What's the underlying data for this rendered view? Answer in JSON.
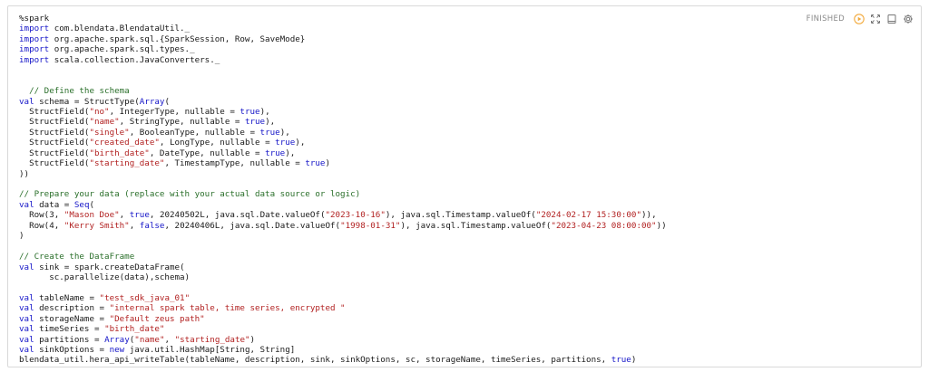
{
  "paragraph": {
    "status": "FINISHED",
    "icons": {
      "run": "play-circle-icon",
      "hide_editor": "expand-arrows-icon",
      "output": "book-icon",
      "settings": "gear-icon"
    },
    "colors": {
      "keyword": "#1515c8",
      "string": "#b22222",
      "comment": "#2a6f2a",
      "run_icon": "#f2a93b"
    }
  },
  "code": {
    "lines": [
      [
        {
          "t": "%spark",
          "c": ""
        }
      ],
      [
        {
          "t": "import",
          "c": "kw"
        },
        {
          "t": " com.blendata.BlendataUtil._",
          "c": ""
        }
      ],
      [
        {
          "t": "import",
          "c": "kw"
        },
        {
          "t": " org.apache.spark.sql.{SparkSession, Row, SaveMode}",
          "c": ""
        }
      ],
      [
        {
          "t": "import",
          "c": "kw"
        },
        {
          "t": " org.apache.spark.sql.types._",
          "c": ""
        }
      ],
      [
        {
          "t": "import",
          "c": "kw"
        },
        {
          "t": " scala.collection.JavaConverters._",
          "c": ""
        }
      ],
      [],
      [],
      [
        {
          "t": "  // Define the schema",
          "c": "cm"
        }
      ],
      [
        {
          "t": "val",
          "c": "kw"
        },
        {
          "t": " schema = StructType(",
          "c": ""
        },
        {
          "t": "Array",
          "c": "kw"
        },
        {
          "t": "(",
          "c": ""
        }
      ],
      [
        {
          "t": "  StructField(",
          "c": ""
        },
        {
          "t": "\"no\"",
          "c": "str"
        },
        {
          "t": ", IntegerType, nullable = ",
          "c": ""
        },
        {
          "t": "true",
          "c": "bool"
        },
        {
          "t": "),",
          "c": ""
        }
      ],
      [
        {
          "t": "  StructField(",
          "c": ""
        },
        {
          "t": "\"name\"",
          "c": "str"
        },
        {
          "t": ", StringType, nullable = ",
          "c": ""
        },
        {
          "t": "true",
          "c": "bool"
        },
        {
          "t": "),",
          "c": ""
        }
      ],
      [
        {
          "t": "  StructField(",
          "c": ""
        },
        {
          "t": "\"single\"",
          "c": "str"
        },
        {
          "t": ", BooleanType, nullable = ",
          "c": ""
        },
        {
          "t": "true",
          "c": "bool"
        },
        {
          "t": "),",
          "c": ""
        }
      ],
      [
        {
          "t": "  StructField(",
          "c": ""
        },
        {
          "t": "\"created_date\"",
          "c": "str"
        },
        {
          "t": ", LongType, nullable = ",
          "c": ""
        },
        {
          "t": "true",
          "c": "bool"
        },
        {
          "t": "),",
          "c": ""
        }
      ],
      [
        {
          "t": "  StructField(",
          "c": ""
        },
        {
          "t": "\"birth_date\"",
          "c": "str"
        },
        {
          "t": ", DateType, nullable = ",
          "c": ""
        },
        {
          "t": "true",
          "c": "bool"
        },
        {
          "t": "),",
          "c": ""
        }
      ],
      [
        {
          "t": "  StructField(",
          "c": ""
        },
        {
          "t": "\"starting_date\"",
          "c": "str"
        },
        {
          "t": ", TimestampType, nullable = ",
          "c": ""
        },
        {
          "t": "true",
          "c": "bool"
        },
        {
          "t": ")",
          "c": ""
        }
      ],
      [
        {
          "t": "))",
          "c": ""
        }
      ],
      [],
      [
        {
          "t": "// Prepare your data (replace with your actual data source or logic)",
          "c": "cm"
        }
      ],
      [
        {
          "t": "val",
          "c": "kw"
        },
        {
          "t": " data = ",
          "c": ""
        },
        {
          "t": "Seq",
          "c": "kw"
        },
        {
          "t": "(",
          "c": ""
        }
      ],
      [
        {
          "t": "  Row(3, ",
          "c": ""
        },
        {
          "t": "\"Mason Doe\"",
          "c": "str"
        },
        {
          "t": ", ",
          "c": ""
        },
        {
          "t": "true",
          "c": "bool"
        },
        {
          "t": ", 20240502L, java.sql.Date.valueOf(",
          "c": ""
        },
        {
          "t": "\"2023-10-16\"",
          "c": "str"
        },
        {
          "t": "), java.sql.Timestamp.valueOf(",
          "c": ""
        },
        {
          "t": "\"2024-02-17 15:30:00\"",
          "c": "str"
        },
        {
          "t": ")),",
          "c": ""
        }
      ],
      [
        {
          "t": "  Row(4, ",
          "c": ""
        },
        {
          "t": "\"Kerry Smith\"",
          "c": "str"
        },
        {
          "t": ", ",
          "c": ""
        },
        {
          "t": "false",
          "c": "bool"
        },
        {
          "t": ", 20240406L, java.sql.Date.valueOf(",
          "c": ""
        },
        {
          "t": "\"1998-01-31\"",
          "c": "str"
        },
        {
          "t": "), java.sql.Timestamp.valueOf(",
          "c": ""
        },
        {
          "t": "\"2023-04-23 08:00:00\"",
          "c": "str"
        },
        {
          "t": "))",
          "c": ""
        }
      ],
      [
        {
          "t": ")",
          "c": ""
        }
      ],
      [],
      [
        {
          "t": "// Create the DataFrame",
          "c": "cm"
        }
      ],
      [
        {
          "t": "val",
          "c": "kw"
        },
        {
          "t": " sink = spark.createDataFrame(",
          "c": ""
        }
      ],
      [
        {
          "t": "      sc.parallelize(data),schema)",
          "c": ""
        }
      ],
      [],
      [
        {
          "t": "val",
          "c": "kw"
        },
        {
          "t": " tableName = ",
          "c": ""
        },
        {
          "t": "\"test_sdk_java_01\"",
          "c": "str"
        }
      ],
      [
        {
          "t": "val",
          "c": "kw"
        },
        {
          "t": " description = ",
          "c": ""
        },
        {
          "t": "\"internal spark table, time series, encrypted \"",
          "c": "str"
        }
      ],
      [
        {
          "t": "val",
          "c": "kw"
        },
        {
          "t": " storageName = ",
          "c": ""
        },
        {
          "t": "\"Default zeus path\"",
          "c": "str"
        }
      ],
      [
        {
          "t": "val",
          "c": "kw"
        },
        {
          "t": " timeSeries = ",
          "c": ""
        },
        {
          "t": "\"birth_date\"",
          "c": "str"
        }
      ],
      [
        {
          "t": "val",
          "c": "kw"
        },
        {
          "t": " partitions = ",
          "c": ""
        },
        {
          "t": "Array",
          "c": "kw"
        },
        {
          "t": "(",
          "c": ""
        },
        {
          "t": "\"name\"",
          "c": "str"
        },
        {
          "t": ", ",
          "c": ""
        },
        {
          "t": "\"starting_date\"",
          "c": "str"
        },
        {
          "t": ")",
          "c": ""
        }
      ],
      [
        {
          "t": "val",
          "c": "kw"
        },
        {
          "t": " sinkOptions = ",
          "c": ""
        },
        {
          "t": "new",
          "c": "kw"
        },
        {
          "t": " java.util.HashMap[String, String]",
          "c": ""
        }
      ],
      [
        {
          "t": "blendata_util.hera_api_writeTable(tableName, description, sink, sinkOptions, sc, storageName, timeSeries, partitions, ",
          "c": ""
        },
        {
          "t": "true",
          "c": "bool"
        },
        {
          "t": ")",
          "c": ""
        }
      ]
    ]
  }
}
